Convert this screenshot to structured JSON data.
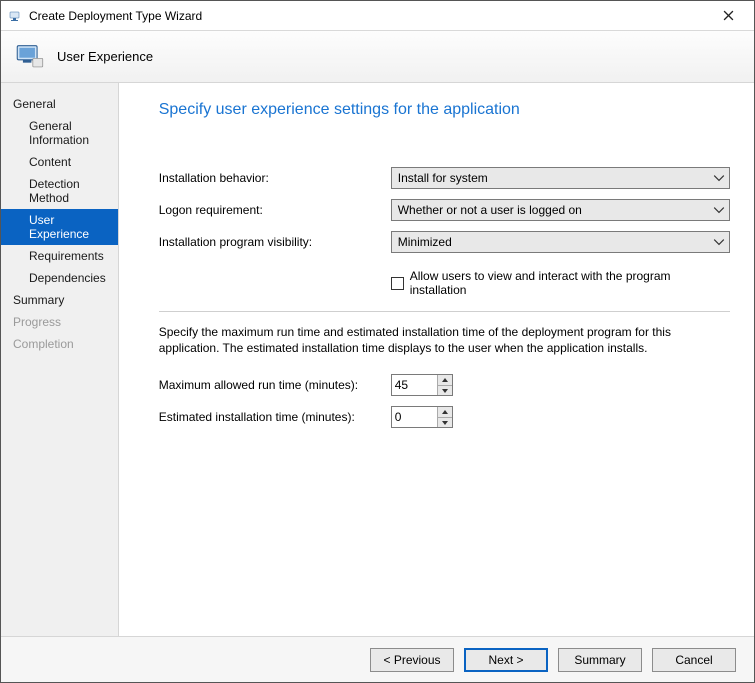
{
  "window": {
    "title": "Create Deployment Type Wizard"
  },
  "header": {
    "label": "User Experience"
  },
  "sidebar": {
    "group": "General",
    "items": [
      "General Information",
      "Content",
      "Detection Method",
      "User Experience",
      "Requirements",
      "Dependencies"
    ],
    "selected_index": 3,
    "trail": [
      "Summary",
      "Progress",
      "Completion"
    ]
  },
  "page": {
    "heading": "Specify user experience settings for the application",
    "labels": {
      "install_behavior": "Installation behavior:",
      "logon_req": "Logon requirement:",
      "visibility": "Installation program visibility:",
      "allow_interact": "Allow users to view and interact with the program installation",
      "instruction": "Specify the maximum run time and estimated installation time of the deployment program for this application. The estimated installation time displays to the user when the application installs.",
      "max_runtime": "Maximum allowed run time (minutes):",
      "est_time": "Estimated installation time (minutes):"
    },
    "values": {
      "install_behavior": "Install for system",
      "logon_req": "Whether or not a user is logged on",
      "visibility": "Minimized",
      "allow_interact": false,
      "max_runtime": "45",
      "est_time": "0"
    }
  },
  "footer": {
    "previous": "< Previous",
    "next": "Next >",
    "summary": "Summary",
    "cancel": "Cancel"
  }
}
